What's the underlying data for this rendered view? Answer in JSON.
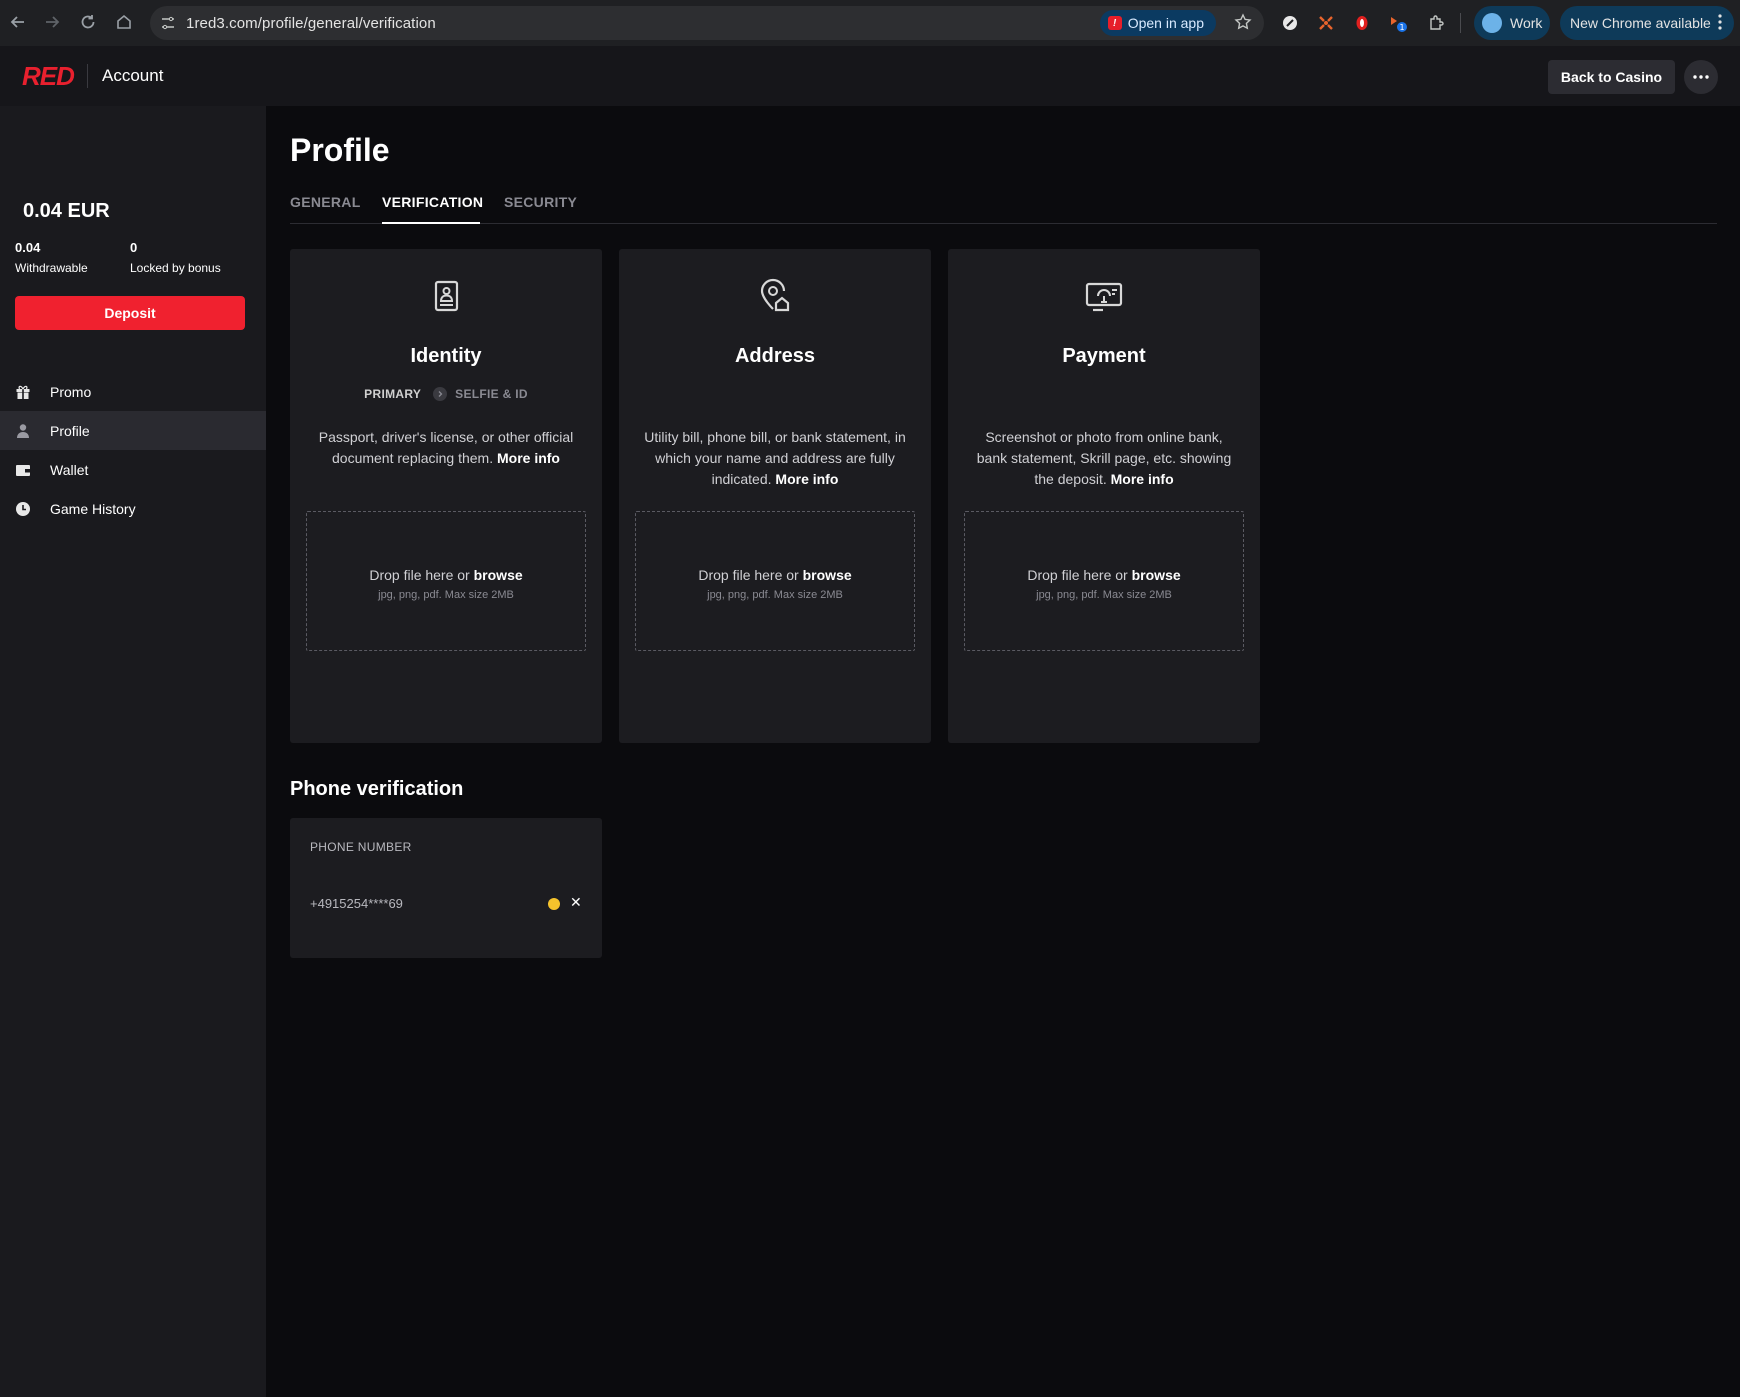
{
  "browser": {
    "url": "1red3.com/profile/general/verification",
    "open_in_app": "Open in app",
    "profile": "Work",
    "update": "New Chrome available"
  },
  "header": {
    "logo": "RED",
    "title": "Account",
    "back_button": "Back to Casino"
  },
  "sidebar": {
    "balance": "0.04  EUR",
    "withdrawable_value": "0.04",
    "withdrawable_label": "Withdrawable",
    "locked_value": "0",
    "locked_label": "Locked by bonus",
    "deposit": "Deposit",
    "items": [
      {
        "label": "Promo",
        "icon": "gift-icon"
      },
      {
        "label": "Profile",
        "icon": "user-icon"
      },
      {
        "label": "Wallet",
        "icon": "wallet-icon"
      },
      {
        "label": "Game History",
        "icon": "clock-icon"
      }
    ]
  },
  "main": {
    "title": "Profile",
    "tabs": [
      {
        "label": "GENERAL"
      },
      {
        "label": "VERIFICATION"
      },
      {
        "label": "SECURITY"
      }
    ],
    "cards": [
      {
        "icon": "id-document-icon",
        "title": "Identity",
        "step_primary": "PRIMARY",
        "step_secondary": "SELFIE & ID",
        "description": "Passport, driver's license, or other official document replacing them.",
        "more_info": "More info",
        "drop_text": "Drop file here or",
        "browse": "browse",
        "formats": "jpg, png, pdf. Max size 2MB"
      },
      {
        "icon": "location-home-icon",
        "title": "Address",
        "description": "Utility bill, phone bill, or bank statement, in which your name and address are fully indicated.",
        "more_info": "More info",
        "drop_text": "Drop file here or",
        "browse": "browse",
        "formats": "jpg, png, pdf. Max size 2MB"
      },
      {
        "icon": "payment-screen-icon",
        "title": "Payment",
        "description": "Screenshot or photo from online bank, bank statement, Skrill page, etc. showing the deposit.",
        "more_info": "More info",
        "drop_text": "Drop file here or",
        "browse": "browse",
        "formats": "jpg, png, pdf. Max size 2MB"
      }
    ],
    "phone": {
      "title": "Phone verification",
      "label": "PHONE NUMBER",
      "value": "+4915254****69",
      "clear": "✕"
    }
  },
  "colors": {
    "accent": "#f0212f",
    "pending": "#f5c32c"
  }
}
